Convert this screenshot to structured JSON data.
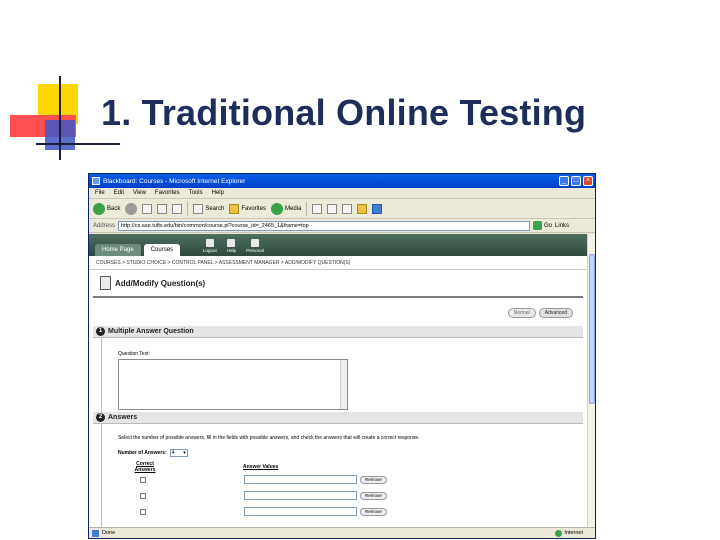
{
  "slide": {
    "title": "1. Traditional Online Testing"
  },
  "browser": {
    "window_title": "Blackboard: Courses - Microsoft Internet Explorer",
    "menu": [
      "File",
      "Edit",
      "View",
      "Favorites",
      "Tools",
      "Help"
    ],
    "toolbar": {
      "back": "Back",
      "search": "Search",
      "favorites": "Favorites",
      "media": "Media"
    },
    "address_label": "Address",
    "url": "http://cs.ase.tufts.edu/bin/common/course.pl?course_id=_2465_1&frame=top",
    "go_label": "Go",
    "links_label": "Links",
    "status_text": "Done",
    "zone_text": "Internet"
  },
  "page": {
    "tabs": [
      "Home Page",
      "Courses"
    ],
    "top_icons": [
      "Logout",
      "Help",
      "Personal"
    ],
    "breadcrumb": "COURSES > STUDIO CHOICE > CONTROL PANEL > ASSESSMENT MANAGER > ADD/MODIFY QUESTION(S)",
    "heading": "Add/Modify Question(s)",
    "buttons": {
      "normal": "Normal",
      "advanced": "Advanced"
    },
    "section1": {
      "number": "1",
      "title": "Multiple Answer Question",
      "question_text_label": "Question Text:"
    },
    "section2": {
      "number": "2",
      "title": "Answers",
      "instructions": "Select the number of possible answers, fill in the fields with possible answers, and check the answers that will create a correct response.",
      "num_answers_label": "Number of Answers:",
      "num_answers_value": "4",
      "col_correct": "Correct Answers",
      "col_values": "Answer Values",
      "remove_label": "Remove"
    }
  }
}
